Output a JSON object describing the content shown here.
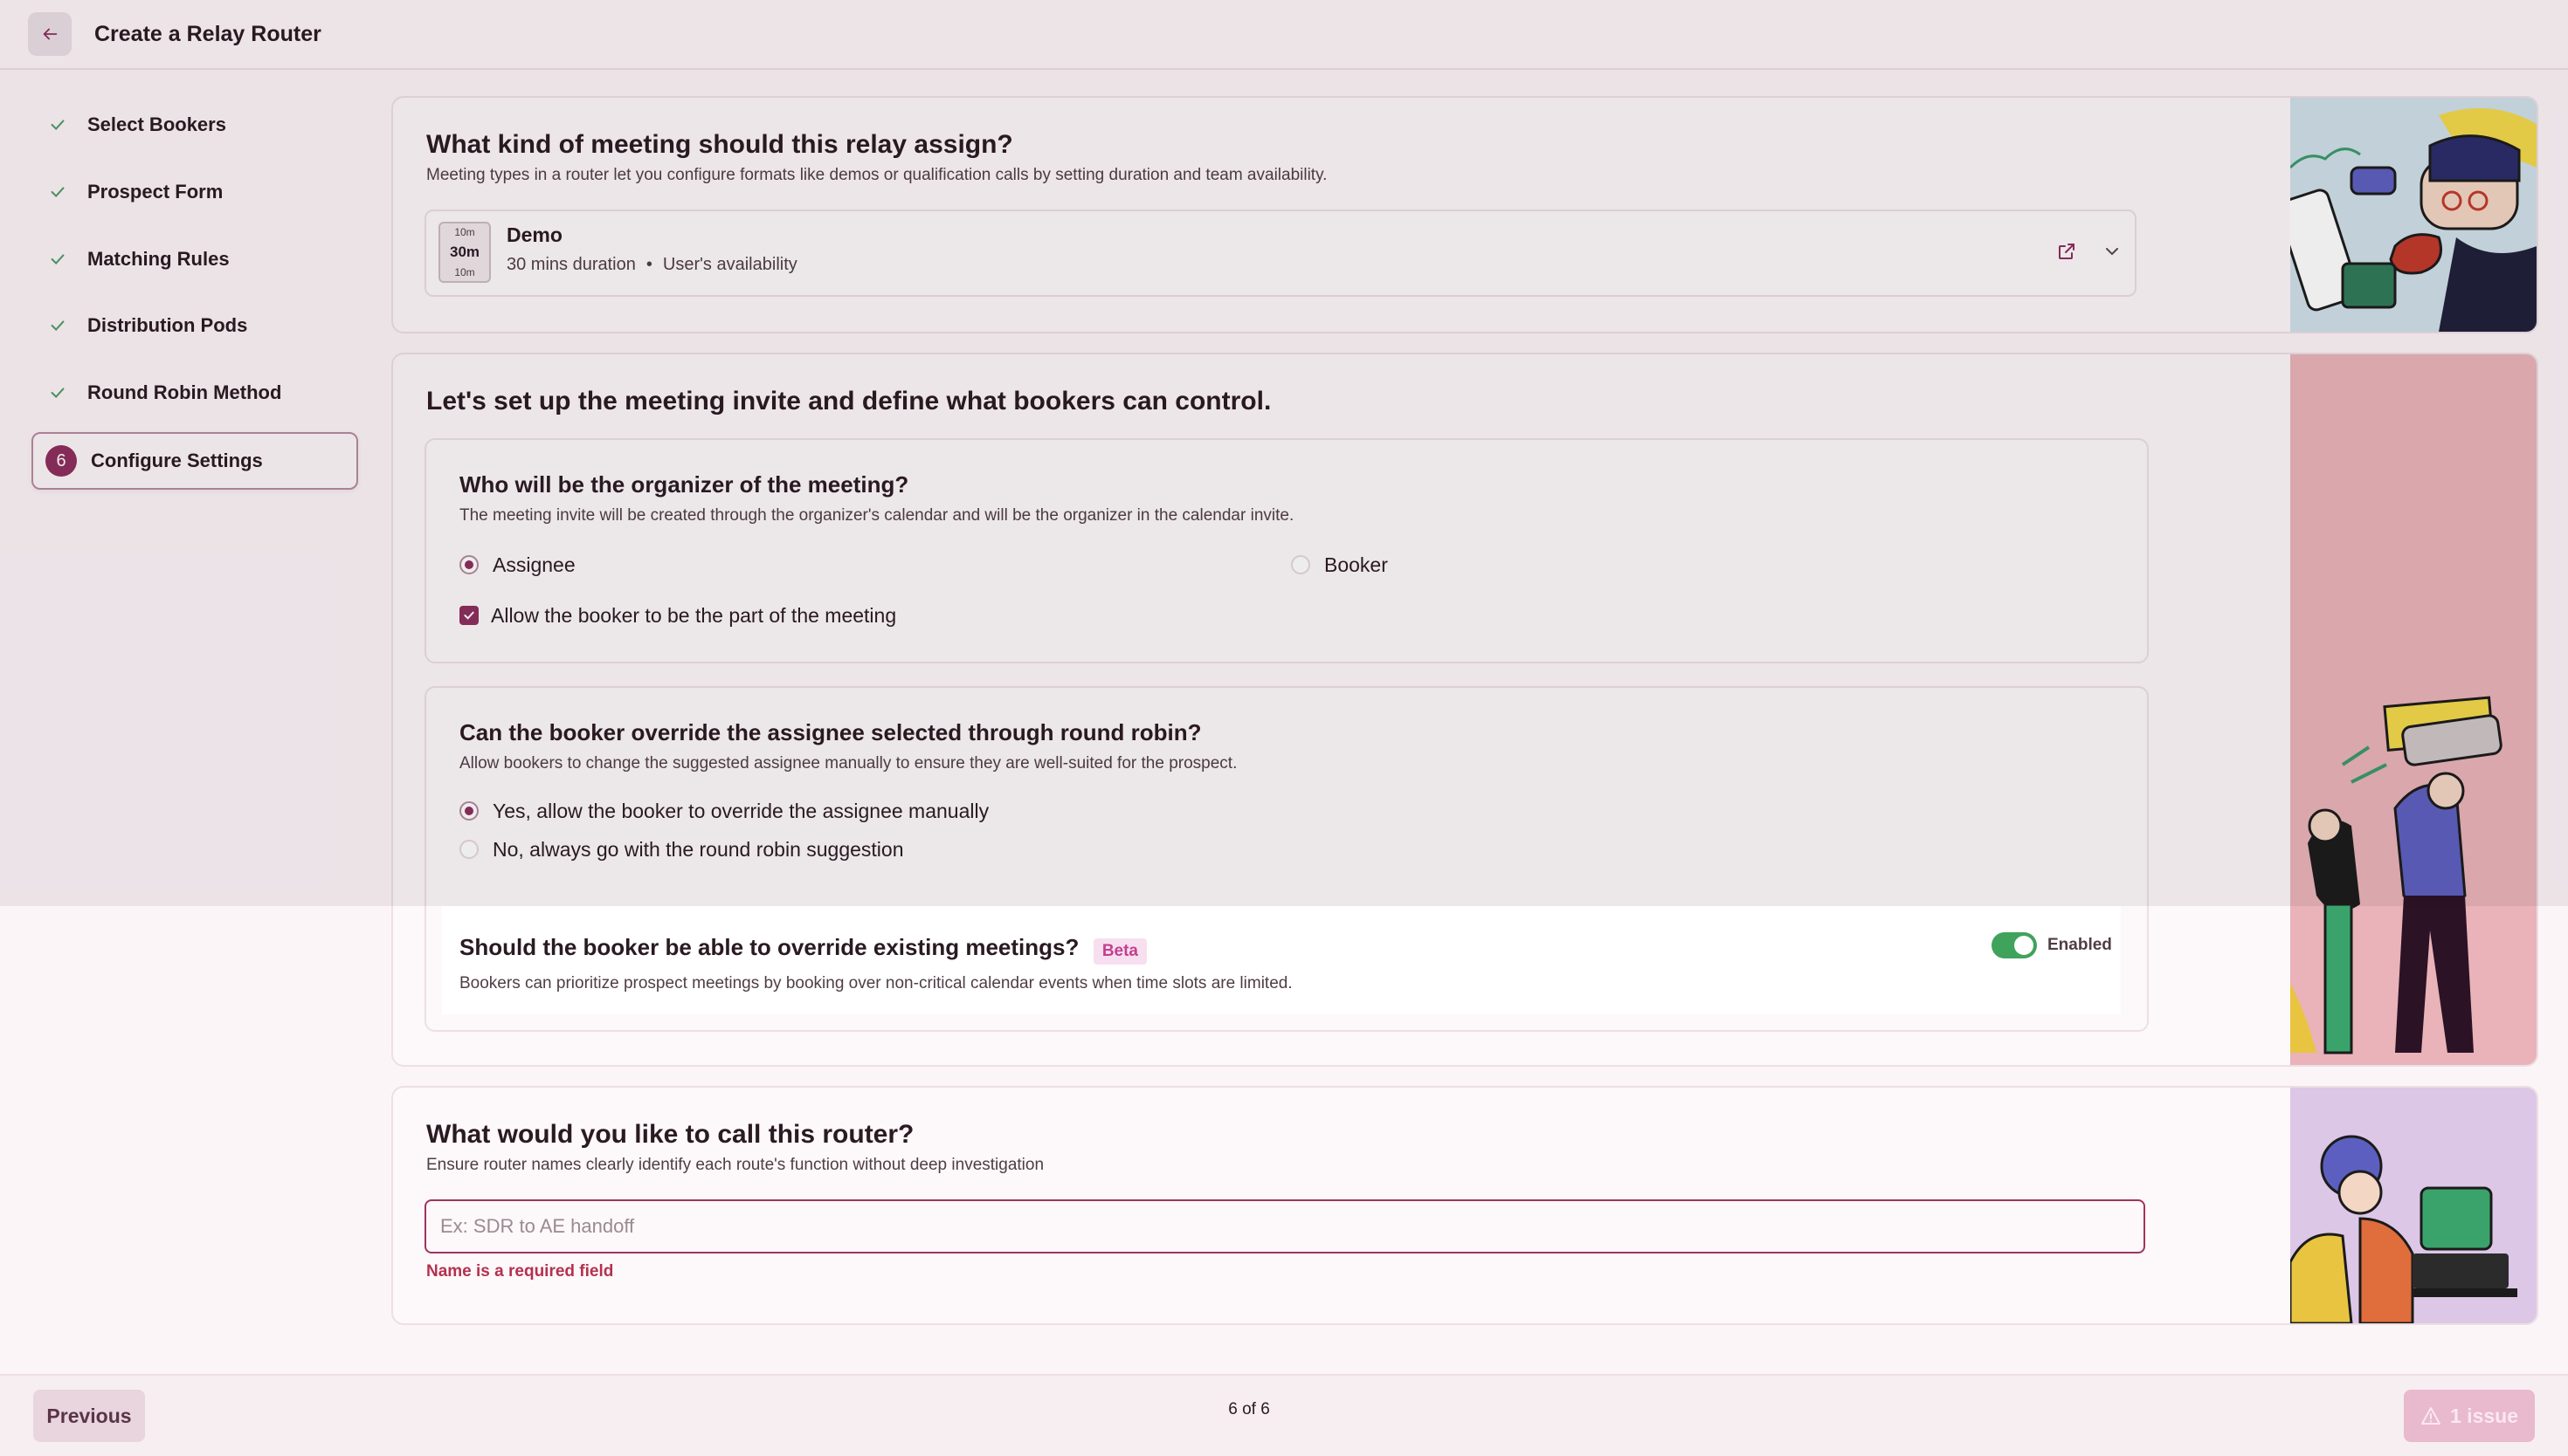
{
  "header": {
    "title": "Create a Relay Router"
  },
  "sidebar": {
    "steps": [
      {
        "label": "Select Bookers"
      },
      {
        "label": "Prospect Form"
      },
      {
        "label": "Matching Rules"
      },
      {
        "label": "Distribution Pods"
      },
      {
        "label": "Round Robin Method"
      },
      {
        "label": "Configure Settings",
        "number": "6"
      }
    ]
  },
  "meeting_type": {
    "title": "What kind of meeting should this relay assign?",
    "description": "Meeting types in a router let you configure formats like demos or qualification calls by setting duration and team availability.",
    "selected": {
      "buffer_before": "10m",
      "duration_badge": "30m",
      "buffer_after": "10m",
      "name": "Demo",
      "duration": "30 mins duration",
      "separator": "•",
      "availability": "User's availability"
    }
  },
  "invite": {
    "title": "Let's set up the meeting invite and define what bookers can control.",
    "organizer": {
      "title": "Who will be the organizer of the meeting?",
      "description": "The meeting invite will be created through the organizer's calendar and will be the organizer in the calendar invite.",
      "option_assignee": "Assignee",
      "option_booker": "Booker",
      "checkbox_label": "Allow the booker to be the part of the meeting"
    },
    "override": {
      "title": "Can the booker override the assignee selected through round robin?",
      "description": "Allow bookers to change the suggested assignee manually to ensure they are well-suited for the prospect.",
      "option_yes": "Yes, allow the booker to override the assignee manually",
      "option_no": "No, always go with the round robin suggestion"
    },
    "existing": {
      "title": "Should the booker be able to override existing meetings?",
      "badge": "Beta",
      "toggle_label": "Enabled",
      "description": "Bookers can prioritize prospect meetings by booking over non-critical calendar events when time slots are limited."
    }
  },
  "router_name": {
    "title": "What would you like to call this router?",
    "description": "Ensure router names clearly identify each route's function without deep investigation",
    "placeholder": "Ex: SDR to AE handoff",
    "error": "Name is a required field"
  },
  "footer": {
    "previous": "Previous",
    "page_indicator": "6 of 6",
    "issues": "1 issue"
  },
  "colors": {
    "accent": "#8c2d5e",
    "toggle_on": "#3fa35b",
    "error": "#b4314f"
  }
}
